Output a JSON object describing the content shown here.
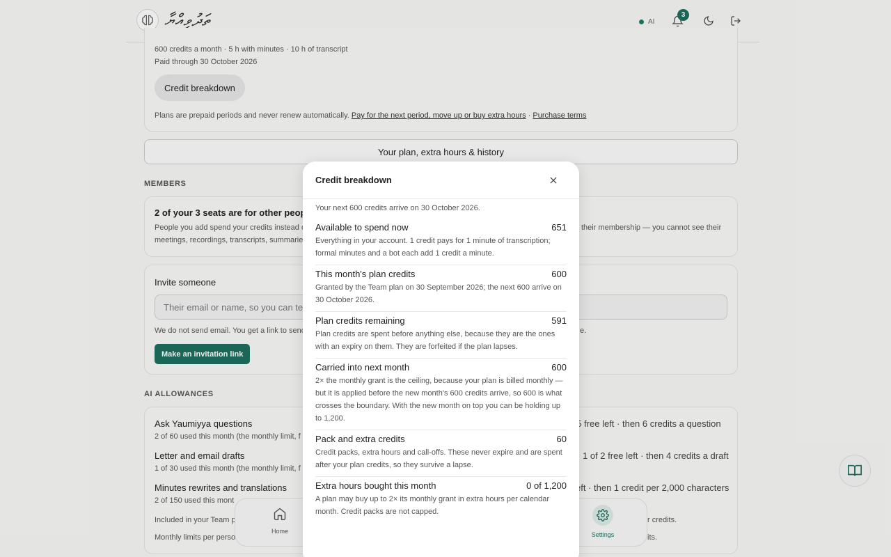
{
  "header": {
    "logo_text": "ތަދުވިއްޔާ",
    "ai_label": "AI",
    "notification_count": "3"
  },
  "plan_card": {
    "line1": "600 credits a month · 5 h with minutes · 10 h of transcript",
    "line2": "Paid through 30 October 2026",
    "credit_breakdown_button": "Credit breakdown",
    "note_prefix": "Plans are prepaid periods and never renew automatically.",
    "note_link1": "Pay for the next period, move up or buy extra hours",
    "note_sep": "·",
    "note_link2": "Purchase terms"
  },
  "plan_history_button": "Your plan, extra hours & history",
  "members": {
    "section_label": "MEMBERS",
    "seats_title": "2 of your 3 seats are for other people",
    "seats_desc_line1_left": "People you add spend your credits instead o",
    "seats_desc_line1_right": "their membership — you cannot see their",
    "seats_desc_line2_left": "meetings, recordings, transcripts, summarie"
  },
  "invite": {
    "title": "Invite someone",
    "input_placeholder": "Their email or name, so you can tell",
    "note_left": "We do not send email. You get a link to send",
    "note_right": "e.",
    "button": "Make an invitation link"
  },
  "ai_allowances": {
    "section_label": "AI ALLOWANCES",
    "items": [
      {
        "title": "Ask Yaumiyya questions",
        "sub": "2 of 60 used this month (the monthly limit, f",
        "right": "f 5 free left · then 6 credits a question"
      },
      {
        "title": "Letter and email drafts",
        "sub": "1 of 30 used this month (the monthly limit, f",
        "right": "1 of 2 free left · then 4 credits a draft"
      },
      {
        "title": "Minutes rewrites and translations",
        "sub": "2 of 150 used this mont",
        "right": "eft · then 1 credit per 2,000 characters"
      }
    ],
    "included_left": "Included in your Team p",
    "included_right": "r credits.",
    "limits_left": "Monthly limits per perso",
    "limits_right": "its."
  },
  "bottom_nav": {
    "home_label": "Home",
    "settings_label": "Settings"
  },
  "modal": {
    "title": "Credit breakdown",
    "intro": "Your next 600 credits arrive on 30 October 2026.",
    "rows": [
      {
        "label": "Available to spend now",
        "value": "651",
        "desc": "Everything in your account. 1 credit pays for 1 minute of transcription; formal minutes and a bot each add 1 credit a minute."
      },
      {
        "label": "This month's plan credits",
        "value": "600",
        "desc": "Granted by the Team plan on 30 September 2026; the next 600 arrive on 30 October 2026."
      },
      {
        "label": "Plan credits remaining",
        "value": "591",
        "desc": "Plan credits are spent before anything else, because they are the ones with an expiry on them. They are forfeited if the plan lapses."
      },
      {
        "label": "Carried into next month",
        "value": "600",
        "desc": "2× the monthly grant is the ceiling, because your plan is billed monthly — but it is applied before the new month's 600 credits arrive, so 600 is what crosses the boundary. With the new month on top you can be holding up to 1,200."
      },
      {
        "label": "Pack and extra credits",
        "value": "60",
        "desc": "Credit packs, extra hours and call-offs. These never expire and are spent after your plan credits, so they survive a lapse."
      },
      {
        "label": "Extra hours bought this month",
        "value": "0 of 1,200",
        "desc": "A plan may buy up to 2× its monthly grant in extra hours per calendar month. Credit packs are not capped."
      }
    ]
  }
}
